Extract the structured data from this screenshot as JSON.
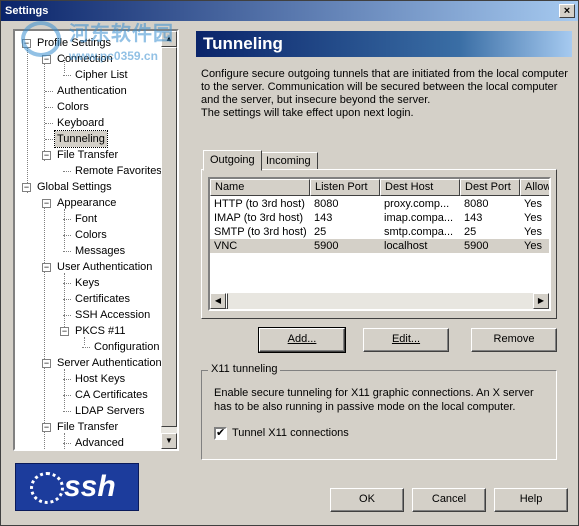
{
  "window": {
    "title": "Settings",
    "close_glyph": "×"
  },
  "watermark": {
    "line1": "河东软件园",
    "line2": "www.pc0359.cn"
  },
  "tree": {
    "items": [
      {
        "label": "Profile Settings"
      },
      {
        "label": "Connection"
      },
      {
        "label": "Cipher List"
      },
      {
        "label": "Authentication"
      },
      {
        "label": "Colors"
      },
      {
        "label": "Keyboard"
      },
      {
        "label": "Tunneling"
      },
      {
        "label": "File Transfer"
      },
      {
        "label": "Remote Favorites"
      },
      {
        "label": "Global Settings"
      },
      {
        "label": "Appearance"
      },
      {
        "label": "Font"
      },
      {
        "label": "Colors"
      },
      {
        "label": "Messages"
      },
      {
        "label": "User Authentication"
      },
      {
        "label": "Keys"
      },
      {
        "label": "Certificates"
      },
      {
        "label": "SSH Accession"
      },
      {
        "label": "PKCS #11"
      },
      {
        "label": "Configuration"
      },
      {
        "label": "Server Authentication"
      },
      {
        "label": "Host Keys"
      },
      {
        "label": "CA Certificates"
      },
      {
        "label": "LDAP Servers"
      },
      {
        "label": "File Transfer"
      },
      {
        "label": "Advanced"
      }
    ],
    "selected": "Tunneling"
  },
  "logo": {
    "text": "ssh"
  },
  "panel": {
    "title": "Tunneling",
    "description": [
      "Configure secure outgoing tunnels that are initiated from the local computer",
      "to the server. Communication will be secured between the local computer",
      "and the server, but insecure beyond the server.",
      "The settings will take effect upon next login."
    ]
  },
  "tabs": [
    {
      "label": "Outgoing",
      "active": true
    },
    {
      "label": "Incoming",
      "active": false
    }
  ],
  "table": {
    "columns": [
      "Name",
      "Listen Port",
      "Dest Host",
      "Dest Port",
      "Allow"
    ],
    "rows": [
      [
        "HTTP (to 3rd host)",
        "8080",
        "proxy.comp...",
        "8080",
        "Yes"
      ],
      [
        "IMAP (to 3rd host)",
        "143",
        "imap.compa...",
        "143",
        "Yes"
      ],
      [
        "SMTP (to 3rd host)",
        "25",
        "smtp.compa...",
        "25",
        "Yes"
      ],
      [
        "VNC",
        "5900",
        "localhost",
        "5900",
        "Yes"
      ]
    ],
    "selected_row": 3
  },
  "buttons": {
    "add": "Add...",
    "edit": "Edit...",
    "remove": "Remove"
  },
  "x11": {
    "group_title": "X11 tunneling",
    "text": [
      "Enable secure tunneling for X11 graphic connections. An X server",
      "has to be also running in passive mode on the local computer."
    ],
    "checkbox_label": "Tunnel X11 connections",
    "checked": true
  },
  "footer": {
    "ok": "OK",
    "cancel": "Cancel",
    "help": "Help"
  },
  "colors": {
    "title_bar": "#0a246a",
    "header": "#0a246a",
    "logo_bg": "#1c3c9c",
    "face": "#d4d0c8"
  }
}
